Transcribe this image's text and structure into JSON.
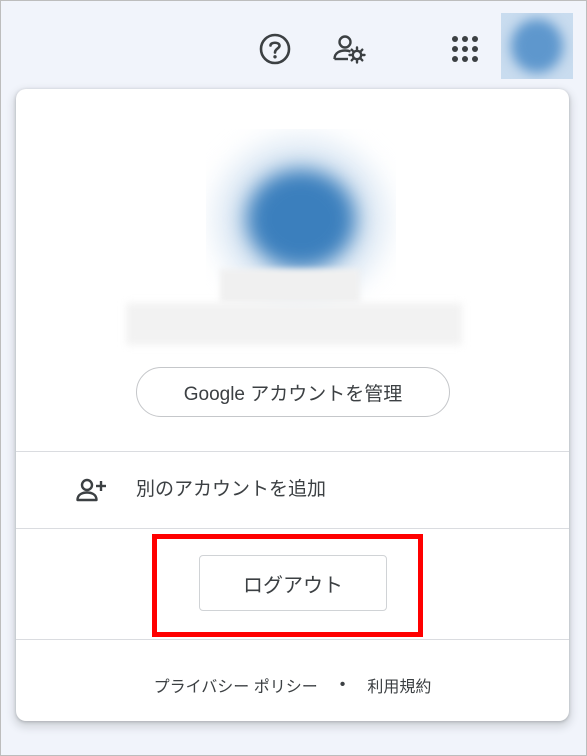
{
  "topbar": {
    "icons": {
      "help": "help-circle-icon",
      "manage": "manage-accounts-icon",
      "apps": "apps-grid-icon"
    }
  },
  "account_menu": {
    "manage_account_label": "Google アカウントを管理",
    "add_account_label": "別のアカウントを追加",
    "add_account_icon": "person-add-icon",
    "logout_label": "ログアウト",
    "footer": {
      "privacy_label": "プライバシー ポリシー",
      "separator": "•",
      "terms_label": "利用規約"
    }
  },
  "colors": {
    "highlight": "#ff0000",
    "avatar": "#3b7fbd",
    "text": "#3c4043",
    "divider": "#dadce0"
  }
}
